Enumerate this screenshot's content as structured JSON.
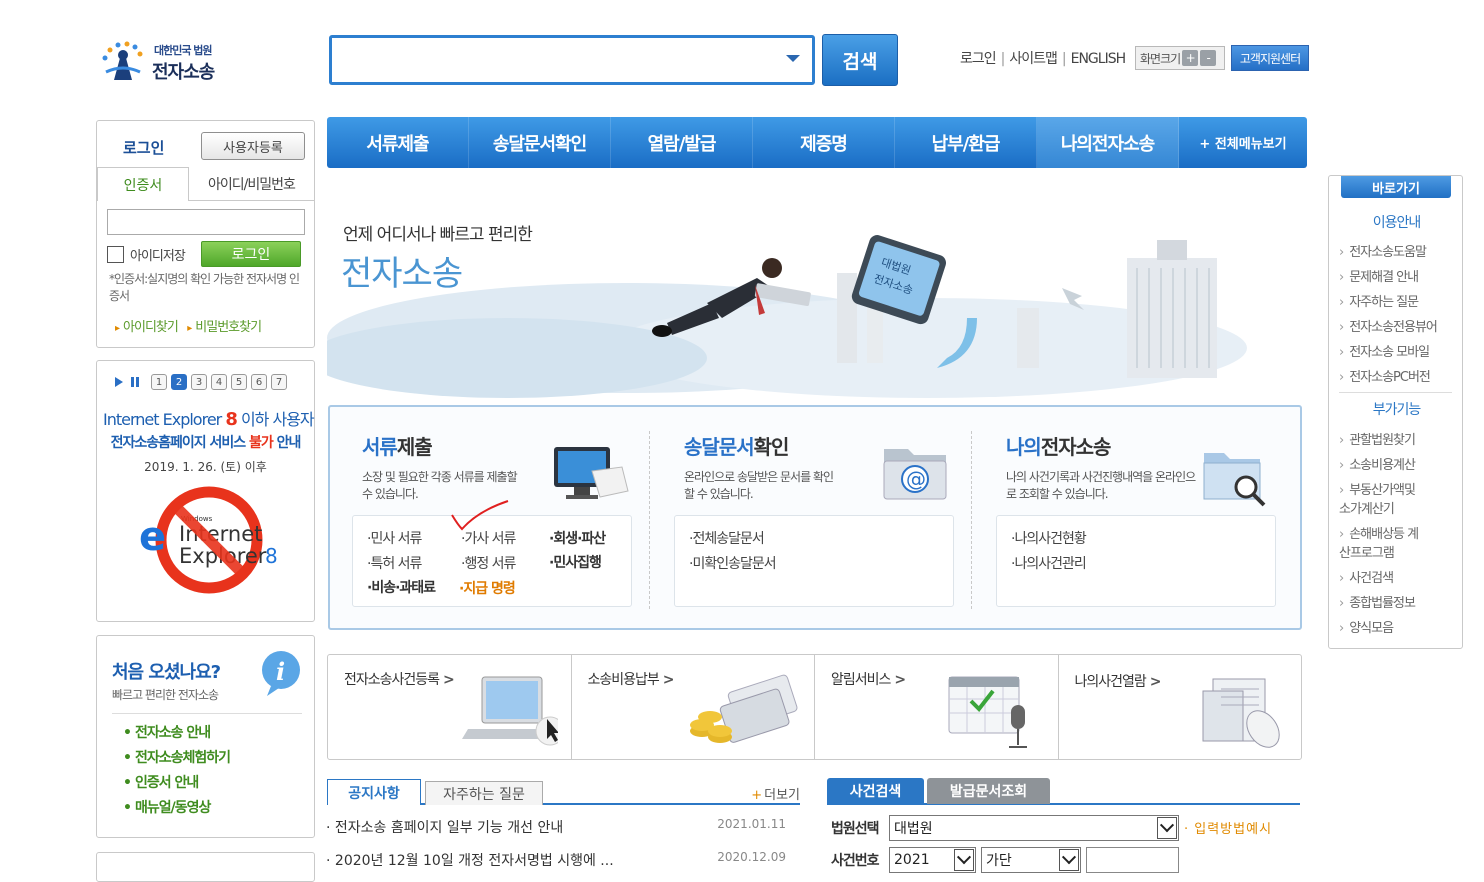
{
  "header": {
    "logo_line1": "대한민국 법원",
    "logo_line2": "전자소송",
    "search_button": "검색",
    "links": [
      "로그인",
      "사이트맵",
      "ENGLISH"
    ],
    "screen_size_label": "화면크기",
    "screen_plus": "+",
    "screen_minus": "-",
    "support_label": "고객지원센터"
  },
  "nav": {
    "items": [
      "서류제출",
      "송달문서확인",
      "열람/발급",
      "제증명",
      "납부/환급",
      "나의전자소송"
    ],
    "all_menu": "+ 전체메뉴보기"
  },
  "login": {
    "title": "로그인",
    "register": "사용자등록",
    "tab_cert": "인증서",
    "tab_id": "아이디/비밀번호",
    "save_id": "아이디저장",
    "login_button": "로그인",
    "cert_note": "*인증서:실지명의 확인 가능한 전자서명 인증서",
    "find_id": "아이디찾기",
    "find_pw": "비밀번호찾기"
  },
  "ie_notice": {
    "pages": [
      "1",
      "2",
      "3",
      "4",
      "5",
      "6",
      "7"
    ],
    "active_page": 2,
    "line1_a": "Internet Explorer ",
    "line1_b": "8",
    "line1_c": " 이하 사용자",
    "line2_a": "전자소송홈페이지 서비스 ",
    "line2_b": "불가",
    "line2_c": " 안내",
    "line3": "2019. 1. 26. (토) 이후",
    "logo_small": "Windows",
    "logo_big1": "Internet",
    "logo_big2": "Explorer",
    "logo_ver": "8"
  },
  "first_visit": {
    "title": "처음 오셨나요?",
    "subtitle": "빠르고 편리한 전자소송",
    "items": [
      "전자소송 안내",
      "전자소송체험하기",
      "인증서 안내",
      "매뉴얼/동영상"
    ]
  },
  "banner": {
    "subtitle": "언제 어디서나 빠르고 편리한",
    "title": "전자소송",
    "monitor_text1": "대법원",
    "monitor_text2": "전자소송"
  },
  "services": [
    {
      "title_hl": "서류",
      "title_rest": "제출",
      "desc": "소장 및 필요한 각종 서류를 제출할 수 있습니다.",
      "links": [
        "·민사 서류",
        "·가사 서류",
        "·회생·파산",
        "·특허 서류",
        "·행정 서류",
        "·민사집행",
        "·비송·과태료",
        "·지급 명령"
      ]
    },
    {
      "title_hl": "송달문서",
      "title_rest": "확인",
      "desc": "온라인으로 송달받은 문서를 확인 할 수 있습니다.",
      "links": [
        "·전체송달문서",
        "·미확인송달문서"
      ]
    },
    {
      "title_hl": "나의",
      "title_rest": "전자소송",
      "desc": "나의 사건기록과 사건진행내역을 온라인으로 조회할 수 있습니다.",
      "links": [
        "·나의사건현황",
        "·나의사건관리"
      ]
    }
  ],
  "tiles": [
    "전자소송사건등록",
    "소송비용납부",
    "알림서비스",
    "나의사건열람"
  ],
  "tile_arrow": ">",
  "notice": {
    "tab_notice": "공지사항",
    "tab_faq": "자주하는 질문",
    "more": "더보기",
    "rows": [
      {
        "title": "전자소송 홈페이지 일부 기능 개선 안내",
        "date": "2021.01.11"
      },
      {
        "title": "2020년 12월 10일 개정 전자서명법 시행에 ...",
        "date": "2020.12.09"
      }
    ]
  },
  "case_search": {
    "tab_case": "사건검색",
    "tab_issue": "발급문서조회",
    "court_label": "법원선택",
    "court_value": "대법원",
    "example": "· 입력방법예시",
    "case_label": "사건번호",
    "year_value": "2021",
    "type_value": "가단"
  },
  "quick": {
    "head": "바로가기",
    "section1": "이용안내",
    "list1": [
      "전자소송도움말",
      "문제해결 안내",
      "자주하는 질문",
      "전자소송전용뷰어",
      "전자소송 모바일",
      "전자소송PC버전"
    ],
    "section2": "부가기능",
    "list2": [
      "관할법원찾기",
      "소송비용계산",
      "부동산가액및 소가계산기",
      "손해배상등 계산프로그램",
      "사건검색",
      "종합법률정보",
      "양식모음"
    ]
  },
  "colors": {
    "accent_blue": "#2b77c5",
    "accent_green": "#4fa72a",
    "accent_orange": "#e07b00",
    "warn_red": "#e8331c"
  }
}
